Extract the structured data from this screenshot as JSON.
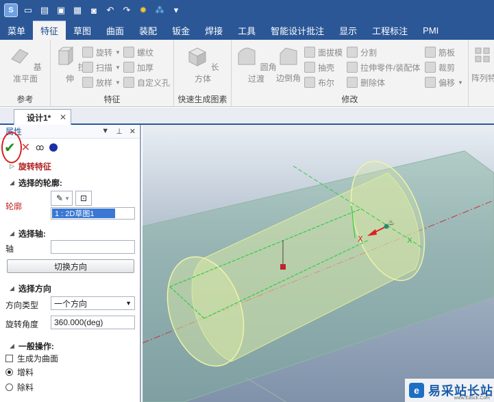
{
  "tabs": [
    "菜单",
    "特征",
    "草图",
    "曲面",
    "装配",
    "钣金",
    "焊接",
    "工具",
    "智能设计批注",
    "显示",
    "工程标注",
    "PMI"
  ],
  "active_tab": "特征",
  "ribbon": {
    "reference": {
      "title": "参考",
      "datum_plane": "基准平面"
    },
    "features": {
      "title": "特征",
      "extrude": "拉伸",
      "revolve": "旋转",
      "sweep": "扫描",
      "loft": "放样",
      "helix": "螺纹",
      "thicken": "加厚",
      "custom_hole": "自定义孔"
    },
    "quick": {
      "title": "快速生成图素",
      "box": "长方体"
    },
    "modify": {
      "title": "修改",
      "fillet": "圆角过渡",
      "chamfer": "边倒角",
      "draft": "面拔模",
      "shell": "抽壳",
      "boolean": "布尔",
      "split": "分割",
      "stretch": "拉伸零件/装配体",
      "delete_body": "删除体",
      "rib": "筋板",
      "trim": "裁剪",
      "offset": "偏移"
    },
    "array": {
      "label": "阵列特"
    }
  },
  "doc_tab": "设计1*",
  "panel": {
    "title": "属性",
    "feature_name": "旋转特征",
    "profile_section": "选择的轮廓:",
    "profile_label": "轮廓",
    "profile_value": "1 : 2D草图1",
    "axis_section": "选择轴:",
    "axis_label": "轴",
    "switch_direction": "切换方向",
    "direction_section": "选择方向",
    "direction_type_label": "方向类型",
    "direction_type_value": "一个方向",
    "angle_label": "旋转角度",
    "angle_value": "360.000(deg)",
    "general_section": "一般操作:",
    "as_surface": "生成为曲面",
    "add_material": "增料",
    "remove_material": "除料"
  },
  "watermark": {
    "text": "易采站长站",
    "sub": "www.Easck.Com"
  }
}
